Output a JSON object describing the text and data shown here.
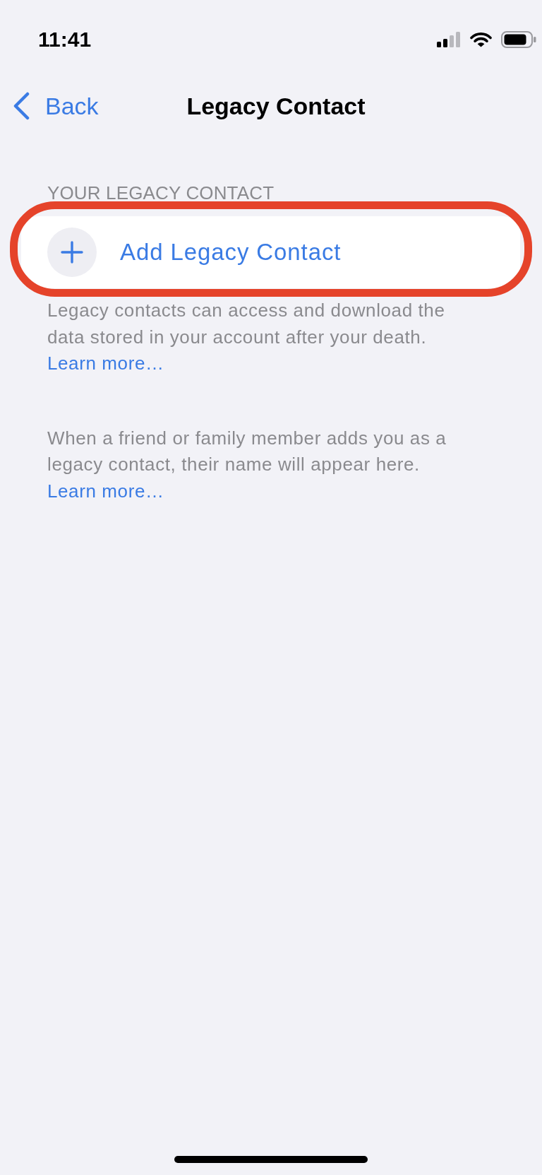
{
  "status_bar": {
    "time": "11:41"
  },
  "nav": {
    "back": "Back",
    "title": "Legacy Contact"
  },
  "section": {
    "header": "YOUR LEGACY CONTACT",
    "add_row": {
      "label": "Add Legacy Contact",
      "highlighted": true
    },
    "footer": {
      "text": "Legacy contacts can access and download the data stored in your account after your death.",
      "link": "Learn more…"
    }
  },
  "info": {
    "text": "When a friend or family member adds you as a legacy contact, their name will appear here.",
    "link": "Learn more…"
  }
}
